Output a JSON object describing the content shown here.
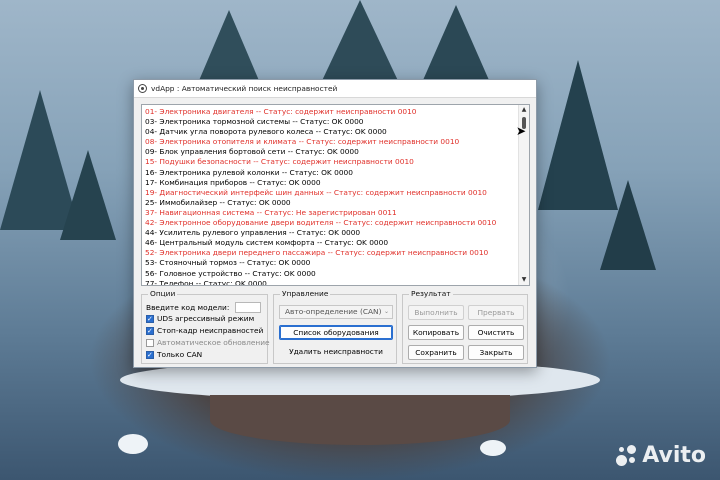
{
  "window": {
    "title": "vdApp : Автоматический поиск неисправностей"
  },
  "list": {
    "items": [
      {
        "text": "01- Электроника двигателя -- Статус: содержит неисправности 0010",
        "error": true
      },
      {
        "text": "03- Электроника тормозной системы -- Статус: OK 0000",
        "error": false
      },
      {
        "text": "04- Датчик угла поворота рулевого колеса -- Статус: OK 0000",
        "error": false
      },
      {
        "text": "08- Электроника отопителя и климата -- Статус: содержит неисправности 0010",
        "error": true
      },
      {
        "text": "09- Блок управления бортовой сети -- Статус: OK 0000",
        "error": false
      },
      {
        "text": "15- Подушки безопасности -- Статус: содержит неисправности 0010",
        "error": true
      },
      {
        "text": "16- Электроника рулевой колонки -- Статус: OK 0000",
        "error": false
      },
      {
        "text": "17- Комбинация приборов -- Статус: OK 0000",
        "error": false
      },
      {
        "text": "19- Диагностический интерфейс шин данных -- Статус: содержит неисправности 0010",
        "error": true
      },
      {
        "text": "25- Иммобилайзер -- Статус: OK 0000",
        "error": false
      },
      {
        "text": "37- Навигационная система -- Статус: Не зарегистрирован 0011",
        "error": true
      },
      {
        "text": "42- Электронное оборудование двери водителя -- Статус: содержит неисправности 0010",
        "error": true
      },
      {
        "text": "44- Усилитель рулевого управления -- Статус: OK 0000",
        "error": false
      },
      {
        "text": "46- Центральный модуль систем комфорта -- Статус: OK 0000",
        "error": false
      },
      {
        "text": "52- Электроника двери переднего пассажира -- Статус: содержит неисправности 0010",
        "error": true
      },
      {
        "text": "53- Стояночный тормоз -- Статус: OK 0000",
        "error": false
      },
      {
        "text": "56- Головное устройство -- Статус: OK 0000",
        "error": false
      },
      {
        "text": "77- Телефон -- Статус: OK 0000",
        "error": false
      }
    ]
  },
  "options": {
    "title": "Опции",
    "model_label": "Введите код модели:",
    "model_value": "",
    "uds_label": "UDS агрессивный режим",
    "uds_checked": true,
    "freeze_label": "Стоп-кадр неисправностей",
    "freeze_checked": true,
    "autoupdate_label": "Автоматическое обновление",
    "autoupdate_checked": false,
    "can_only_label": "Только CAN",
    "can_only_checked": true
  },
  "control": {
    "title": "Управление",
    "select_value": "Авто-определение (CAN)",
    "equipment_button": "Список оборудования",
    "delete_faults_button": "Удалить неисправности"
  },
  "result": {
    "title": "Результат",
    "run_button": "Выполнить",
    "abort_button": "Прервать",
    "copy_button": "Копировать",
    "clear_button": "Очистить",
    "save_button": "Сохранить",
    "close_button": "Закрыть"
  },
  "watermark": {
    "text": "Avito"
  },
  "colors": {
    "error_text": "#e0302a",
    "accent": "#2a6fd0"
  }
}
